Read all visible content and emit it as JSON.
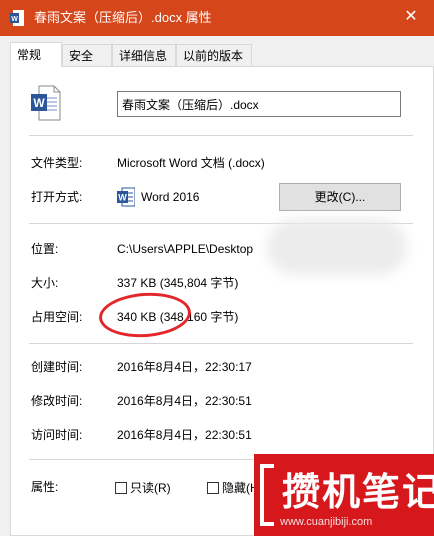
{
  "window": {
    "title": "春雨文案（压缩后）.docx 属性",
    "close_symbol": "✕"
  },
  "tabs": [
    {
      "label": "常规",
      "active": true
    },
    {
      "label": "安全",
      "active": false
    },
    {
      "label": "详细信息",
      "active": false
    },
    {
      "label": "以前的版本",
      "active": false
    }
  ],
  "general": {
    "file_name": "春雨文案（压缩后）.docx",
    "file_type_label": "文件类型:",
    "file_type_value": "Microsoft Word 文档 (.docx)",
    "open_with_label": "打开方式:",
    "open_with_value": "Word 2016",
    "change_button": "更改(C)...",
    "location_label": "位置:",
    "location_value": "C:\\Users\\APPLE\\Desktop",
    "size_label": "大小:",
    "size_value": "337 KB (345,804 字节)",
    "size_on_disk_label": "占用空间:",
    "size_on_disk_value": "340 KB (348,160 字节)",
    "created_label": "创建时间:",
    "created_value": "2016年8月4日，22:30:17",
    "modified_label": "修改时间:",
    "modified_value": "2016年8月4日，22:30:51",
    "accessed_label": "访问时间:",
    "accessed_value": "2016年8月4日，22:30:51",
    "attributes_label": "属性:",
    "readonly_label": "只读(R)",
    "readonly_checked": false,
    "hidden_label": "隐藏(H)",
    "hidden_checked": false
  },
  "watermark": {
    "main": "攒机笔记",
    "sub": "www.cuanjibiji.com"
  },
  "colors": {
    "titlebar": "#d5461a",
    "annotation_circle": "#e4262a",
    "watermark_bg": "#d6171c",
    "word_blue": "#2b579a"
  },
  "icons": {
    "file": "word-document-icon",
    "app": "word-app-icon"
  }
}
